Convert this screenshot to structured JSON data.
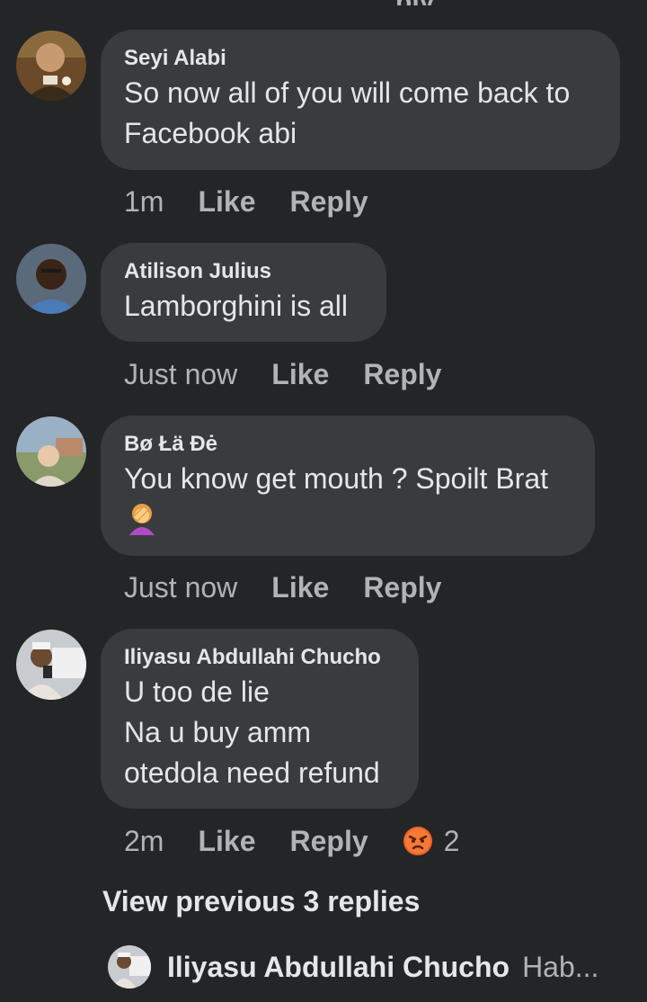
{
  "comments": [
    {
      "author": "Seyi Alabi",
      "text": "So now all of you will come back to\nFacebook abi",
      "time": "1m",
      "like_label": "Like",
      "reply_label": "Reply"
    },
    {
      "author": "Atilison Julius",
      "text": "Lamborghini is all",
      "time": "Just now",
      "like_label": "Like",
      "reply_label": "Reply"
    },
    {
      "author": "Bø Łä Đė",
      "text": "You know get mouth ? Spoilt Brat",
      "emoji": "face-palm-emoji",
      "time": "Just now",
      "like_label": "Like",
      "reply_label": "Reply"
    },
    {
      "author": "Iliyasu Abdullahi Chucho",
      "text": "U too de lie\nNa u buy amm\notedola need refund",
      "time": "2m",
      "like_label": "Like",
      "reply_label": "Reply",
      "reaction_icon": "angry-reaction-icon",
      "reaction_count": "2"
    }
  ],
  "view_previous_label": "View previous 3 replies",
  "reply_preview": {
    "author": "Iliyasu Abdullahi Chucho",
    "snippet": "Hab..."
  },
  "colors": {
    "background": "#242526",
    "bubble": "#3a3b3c",
    "primary_text": "#e4e6eb",
    "secondary_text": "#b0b3b8",
    "angry_reaction": "#f0612a"
  }
}
